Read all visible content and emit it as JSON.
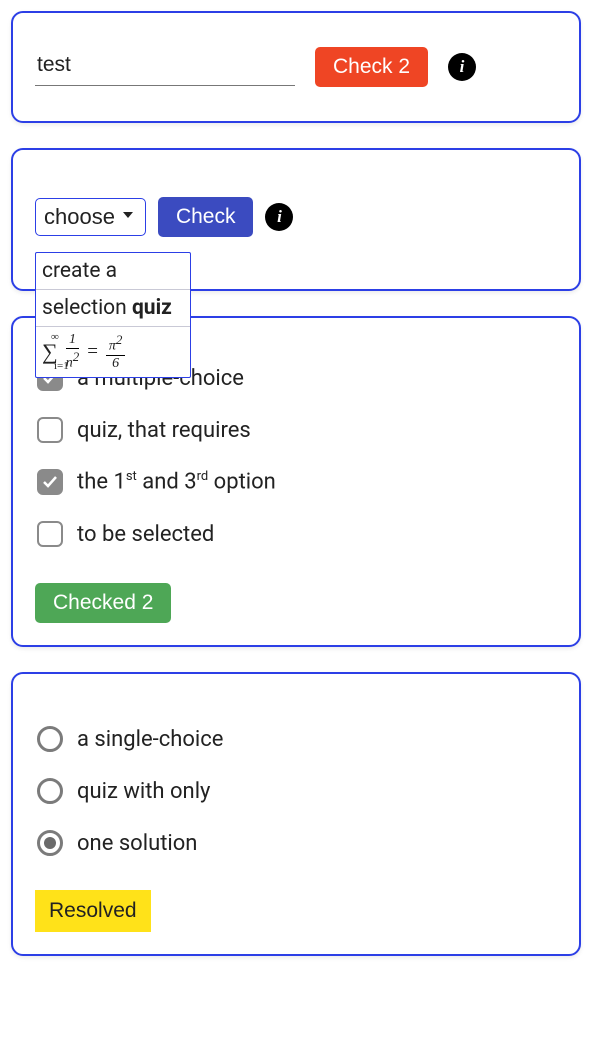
{
  "card1": {
    "input_value": "test",
    "check_label": "Check 2"
  },
  "card2": {
    "select_label": "choose",
    "check_label": "Check",
    "dropdown": {
      "row1": "create a",
      "row2_pre": "selection ",
      "row2_bold": "quiz"
    }
  },
  "card3": {
    "options": [
      {
        "label": "a multiple-choice",
        "checked": true
      },
      {
        "label": "quiz, that requires",
        "checked": false
      },
      {
        "label_html": "the 1<span class=\"sup\">st</span> and 3<span class=\"sup\">rd</span> option",
        "checked": true
      },
      {
        "label": "to be selected",
        "checked": false
      }
    ],
    "button_label": "Checked 2"
  },
  "card4": {
    "options": [
      {
        "label": "a single-choice",
        "selected": false
      },
      {
        "label": "quiz with only",
        "selected": false
      },
      {
        "label": "one solution",
        "selected": true
      }
    ],
    "button_label": "Resolved"
  }
}
